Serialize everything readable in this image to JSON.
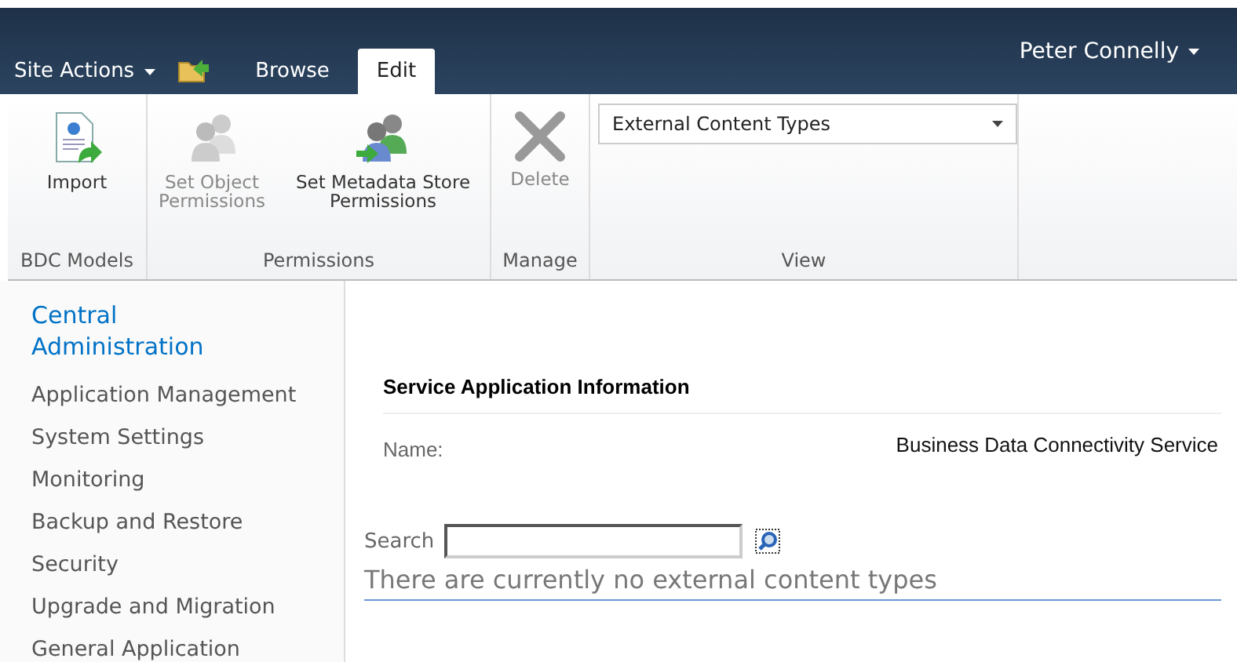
{
  "top_bar": {
    "site_actions": "Site Actions",
    "tabs": [
      {
        "label": "Browse",
        "selected": false
      },
      {
        "label": "Edit",
        "selected": true
      }
    ],
    "user": "Peter Connelly"
  },
  "ribbon": {
    "groups": [
      {
        "label": "BDC Models",
        "items": [
          {
            "kind": "import",
            "label": "Import",
            "disabled": false
          }
        ]
      },
      {
        "label": "Permissions",
        "items": [
          {
            "kind": "people",
            "label": "Set Object Permissions",
            "disabled": true
          },
          {
            "kind": "peoplearrow",
            "label": "Set Metadata Store Permissions",
            "disabled": false
          }
        ]
      },
      {
        "label": "Manage",
        "items": [
          {
            "kind": "delete",
            "label": "Delete",
            "disabled": true
          }
        ]
      },
      {
        "label": "View",
        "items": [
          {
            "kind": "dropdown",
            "value": "External Content Types"
          }
        ]
      }
    ]
  },
  "nav": {
    "title": "Central Administration",
    "items": [
      "Application Management",
      "System Settings",
      "Monitoring",
      "Backup and Restore",
      "Security",
      "Upgrade and Migration",
      "General Application"
    ]
  },
  "content": {
    "section_title": "Service Application Information",
    "name_label": "Name:",
    "name_value": "Business Data Connectivity Service",
    "search_label": "Search",
    "empty_message": "There are currently no external content types"
  }
}
